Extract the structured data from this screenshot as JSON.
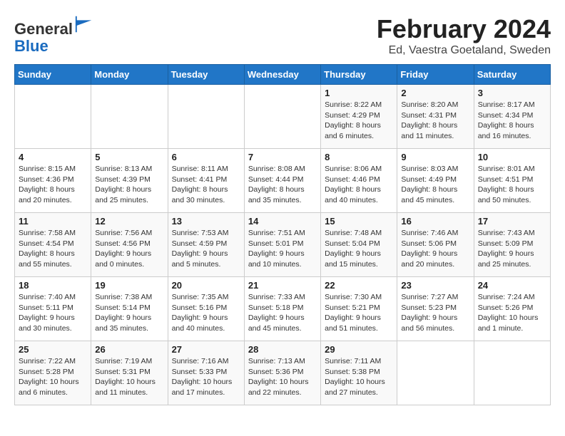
{
  "header": {
    "logo_general": "General",
    "logo_blue": "Blue",
    "month": "February 2024",
    "location": "Ed, Vaestra Goetaland, Sweden"
  },
  "weekdays": [
    "Sunday",
    "Monday",
    "Tuesday",
    "Wednesday",
    "Thursday",
    "Friday",
    "Saturday"
  ],
  "weeks": [
    [
      {
        "day": "",
        "info": ""
      },
      {
        "day": "",
        "info": ""
      },
      {
        "day": "",
        "info": ""
      },
      {
        "day": "",
        "info": ""
      },
      {
        "day": "1",
        "info": "Sunrise: 8:22 AM\nSunset: 4:29 PM\nDaylight: 8 hours\nand 6 minutes."
      },
      {
        "day": "2",
        "info": "Sunrise: 8:20 AM\nSunset: 4:31 PM\nDaylight: 8 hours\nand 11 minutes."
      },
      {
        "day": "3",
        "info": "Sunrise: 8:17 AM\nSunset: 4:34 PM\nDaylight: 8 hours\nand 16 minutes."
      }
    ],
    [
      {
        "day": "4",
        "info": "Sunrise: 8:15 AM\nSunset: 4:36 PM\nDaylight: 8 hours\nand 20 minutes."
      },
      {
        "day": "5",
        "info": "Sunrise: 8:13 AM\nSunset: 4:39 PM\nDaylight: 8 hours\nand 25 minutes."
      },
      {
        "day": "6",
        "info": "Sunrise: 8:11 AM\nSunset: 4:41 PM\nDaylight: 8 hours\nand 30 minutes."
      },
      {
        "day": "7",
        "info": "Sunrise: 8:08 AM\nSunset: 4:44 PM\nDaylight: 8 hours\nand 35 minutes."
      },
      {
        "day": "8",
        "info": "Sunrise: 8:06 AM\nSunset: 4:46 PM\nDaylight: 8 hours\nand 40 minutes."
      },
      {
        "day": "9",
        "info": "Sunrise: 8:03 AM\nSunset: 4:49 PM\nDaylight: 8 hours\nand 45 minutes."
      },
      {
        "day": "10",
        "info": "Sunrise: 8:01 AM\nSunset: 4:51 PM\nDaylight: 8 hours\nand 50 minutes."
      }
    ],
    [
      {
        "day": "11",
        "info": "Sunrise: 7:58 AM\nSunset: 4:54 PM\nDaylight: 8 hours\nand 55 minutes."
      },
      {
        "day": "12",
        "info": "Sunrise: 7:56 AM\nSunset: 4:56 PM\nDaylight: 9 hours\nand 0 minutes."
      },
      {
        "day": "13",
        "info": "Sunrise: 7:53 AM\nSunset: 4:59 PM\nDaylight: 9 hours\nand 5 minutes."
      },
      {
        "day": "14",
        "info": "Sunrise: 7:51 AM\nSunset: 5:01 PM\nDaylight: 9 hours\nand 10 minutes."
      },
      {
        "day": "15",
        "info": "Sunrise: 7:48 AM\nSunset: 5:04 PM\nDaylight: 9 hours\nand 15 minutes."
      },
      {
        "day": "16",
        "info": "Sunrise: 7:46 AM\nSunset: 5:06 PM\nDaylight: 9 hours\nand 20 minutes."
      },
      {
        "day": "17",
        "info": "Sunrise: 7:43 AM\nSunset: 5:09 PM\nDaylight: 9 hours\nand 25 minutes."
      }
    ],
    [
      {
        "day": "18",
        "info": "Sunrise: 7:40 AM\nSunset: 5:11 PM\nDaylight: 9 hours\nand 30 minutes."
      },
      {
        "day": "19",
        "info": "Sunrise: 7:38 AM\nSunset: 5:14 PM\nDaylight: 9 hours\nand 35 minutes."
      },
      {
        "day": "20",
        "info": "Sunrise: 7:35 AM\nSunset: 5:16 PM\nDaylight: 9 hours\nand 40 minutes."
      },
      {
        "day": "21",
        "info": "Sunrise: 7:33 AM\nSunset: 5:18 PM\nDaylight: 9 hours\nand 45 minutes."
      },
      {
        "day": "22",
        "info": "Sunrise: 7:30 AM\nSunset: 5:21 PM\nDaylight: 9 hours\nand 51 minutes."
      },
      {
        "day": "23",
        "info": "Sunrise: 7:27 AM\nSunset: 5:23 PM\nDaylight: 9 hours\nand 56 minutes."
      },
      {
        "day": "24",
        "info": "Sunrise: 7:24 AM\nSunset: 5:26 PM\nDaylight: 10 hours\nand 1 minute."
      }
    ],
    [
      {
        "day": "25",
        "info": "Sunrise: 7:22 AM\nSunset: 5:28 PM\nDaylight: 10 hours\nand 6 minutes."
      },
      {
        "day": "26",
        "info": "Sunrise: 7:19 AM\nSunset: 5:31 PM\nDaylight: 10 hours\nand 11 minutes."
      },
      {
        "day": "27",
        "info": "Sunrise: 7:16 AM\nSunset: 5:33 PM\nDaylight: 10 hours\nand 17 minutes."
      },
      {
        "day": "28",
        "info": "Sunrise: 7:13 AM\nSunset: 5:36 PM\nDaylight: 10 hours\nand 22 minutes."
      },
      {
        "day": "29",
        "info": "Sunrise: 7:11 AM\nSunset: 5:38 PM\nDaylight: 10 hours\nand 27 minutes."
      },
      {
        "day": "",
        "info": ""
      },
      {
        "day": "",
        "info": ""
      }
    ]
  ]
}
